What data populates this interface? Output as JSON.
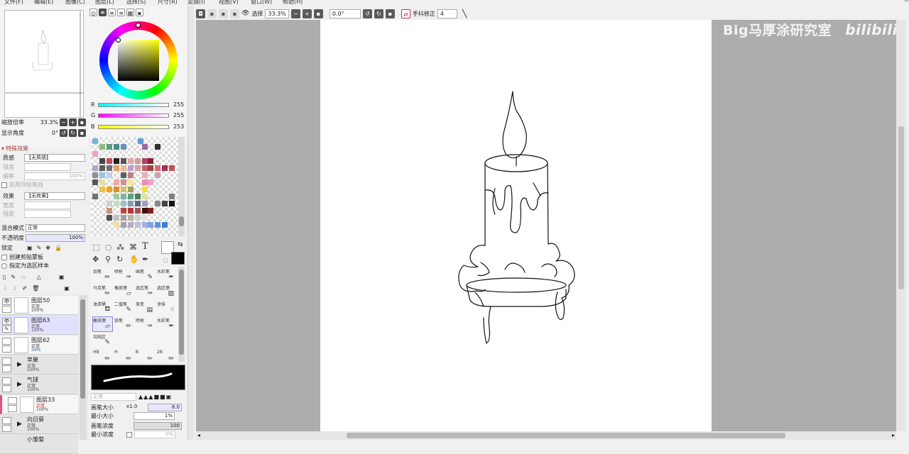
{
  "menu": [
    "文件(F)",
    "编辑(E)",
    "图像(C)",
    "图层(L)",
    "选择(S)",
    "尺寸(R)",
    "滤镜(I)",
    "视图(V)",
    "窗口(W)",
    "帮助(H)"
  ],
  "window_controls": [
    "—",
    "□",
    "✕"
  ],
  "navigator": {
    "zoom_label": "缩放倍率",
    "zoom_value": "33.3%",
    "angle_label": "显示角度",
    "angle_value": "0°"
  },
  "effects": {
    "title": "特殊效果",
    "texture_label": "质感",
    "texture_value": "【无质感】",
    "strength_label": "强度",
    "scale_label": "缩率",
    "scale_value": "100%",
    "apply_label": "应用到绘笔线",
    "effect_label": "效果",
    "effect_value": "【无效果】",
    "width_label": "宽度",
    "intensity_label": "强度"
  },
  "blend": {
    "mode_label": "混合模式",
    "mode_value": "正常",
    "opacity_label": "不透明度",
    "opacity_value": "100%",
    "lock_label": "锁定",
    "clip_label": "创建剪贴蒙板",
    "sample_label": "指定为选区样本"
  },
  "layers": [
    {
      "name": "图层50",
      "mode": "正常",
      "opacity": "100%",
      "folder": false,
      "selected": false
    },
    {
      "name": "图层63",
      "mode": "正常",
      "opacity": "100%",
      "folder": false,
      "selected": true
    },
    {
      "name": "图层62",
      "mode": "正常",
      "opacity": "34%",
      "folder": false,
      "selected": false
    },
    {
      "name": "苹果",
      "mode": "正常",
      "opacity": "100%",
      "folder": true,
      "selected": false
    },
    {
      "name": "气球",
      "mode": "正常",
      "opacity": "100%",
      "folder": true,
      "selected": false
    },
    {
      "name": "图层33",
      "mode": "正常",
      "opacity": "100%",
      "folder": false,
      "selected": false
    },
    {
      "name": "向日葵",
      "mode": "正常",
      "opacity": "100%",
      "folder": true,
      "selected": false
    },
    {
      "name": "小雏菊",
      "mode": "",
      "opacity": "",
      "folder": true,
      "selected": false
    }
  ],
  "color": {
    "r_label": "R",
    "r_value": "255",
    "g_label": "G",
    "g_value": "255",
    "b_label": "B",
    "b_value": "253",
    "current": "#fffffd"
  },
  "tools": [
    {
      "label": "铅笔",
      "icon": "pencil-icon"
    },
    {
      "label": "喷枪",
      "icon": "airbrush-icon"
    },
    {
      "label": "画笔",
      "icon": "brush-icon"
    },
    {
      "label": "水彩笔",
      "icon": "watercolor-icon"
    },
    {
      "label": "马克笔",
      "icon": "marker-icon"
    },
    {
      "label": "橡皮擦",
      "icon": "eraser-icon"
    },
    {
      "label": "选区笔",
      "icon": "select-pen-icon"
    },
    {
      "label": "选区擦",
      "icon": "select-eraser-icon"
    },
    {
      "label": "油漆桶",
      "icon": "bucket-icon"
    },
    {
      "label": "二值笔",
      "icon": "binary-pen-icon"
    },
    {
      "label": "渐变",
      "icon": "gradient-icon"
    },
    {
      "label": "涂抹",
      "icon": "smudge-icon"
    },
    {
      "label": "橡皮擦",
      "icon": "eraser-icon"
    },
    {
      "label": "铅笔",
      "icon": "pencil-icon"
    },
    {
      "label": "喷枪",
      "icon": "airbrush-icon"
    },
    {
      "label": "水彩笔",
      "icon": "watercolor-icon"
    },
    {
      "label": "勾线区",
      "icon": "outline-icon"
    },
    {
      "label": "",
      "icon": ""
    },
    {
      "label": "",
      "icon": ""
    },
    {
      "label": "",
      "icon": ""
    },
    {
      "label": "HB",
      "icon": "pencil-icon"
    },
    {
      "label": "H",
      "icon": "pencil-icon"
    },
    {
      "label": "B",
      "icon": "pencil-icon"
    },
    {
      "label": "2B",
      "icon": "pencil-icon"
    }
  ],
  "brush": {
    "mode_value": "正常",
    "size_label": "画笔大小",
    "size_mult": "x1.0",
    "size_value": "8.0",
    "min_size_label": "最小大小",
    "min_size_value": "1%",
    "density_label": "画笔浓度",
    "density_value": "100",
    "min_density_label": "最小浓度",
    "min_density_value": "0%"
  },
  "toolbar": {
    "select_label": "选择",
    "zoom_value": "33.3%",
    "angle_value": "0.0°",
    "stabilizer_label": "手抖修正",
    "stabilizer_value": "4"
  },
  "watermark": "Big马厚涂研究室",
  "watermark_logo": "bilibili"
}
